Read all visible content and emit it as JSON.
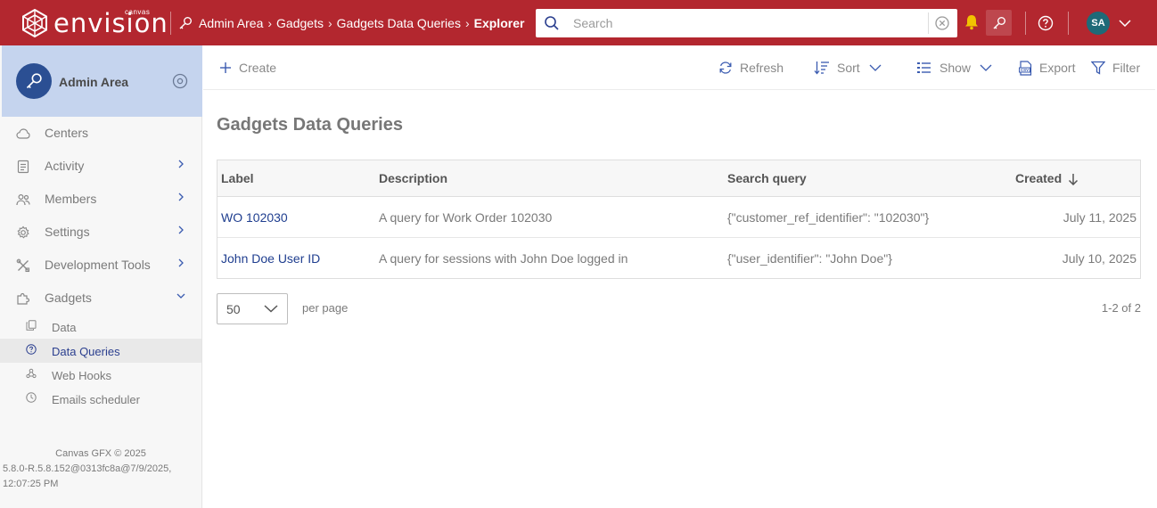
{
  "brand": {
    "small_word": "canvas",
    "name": "envision"
  },
  "breadcrumb": [
    "Admin Area",
    "Gadgets",
    "Gadgets Data Queries",
    "Explorer"
  ],
  "search": {
    "placeholder": "Search",
    "value": ""
  },
  "user": {
    "initials": "SA"
  },
  "sidebar": {
    "header_title": "Admin Area",
    "items": [
      {
        "label": "Centers",
        "icon": "cloud-icon"
      },
      {
        "label": "Activity",
        "icon": "activity-icon"
      },
      {
        "label": "Members",
        "icon": "members-icon"
      },
      {
        "label": "Settings",
        "icon": "gear-icon"
      },
      {
        "label": "Development Tools",
        "icon": "tools-icon"
      },
      {
        "label": "Gadgets",
        "icon": "puzzle-icon"
      }
    ],
    "subitems": [
      {
        "label": "Data",
        "icon": "copy-icon"
      },
      {
        "label": "Data Queries",
        "icon": "question-icon",
        "active": true
      },
      {
        "label": "Web Hooks",
        "icon": "webhook-icon"
      },
      {
        "label": "Emails scheduler",
        "icon": "clock-icon"
      }
    ],
    "footer": {
      "line1": "Canvas GFX © 2025",
      "line2": "5.8.0-R.5.8.152@0313fc8a@7/9/2025,",
      "line3": "12:07:25 PM"
    }
  },
  "toolbar": {
    "create": "Create",
    "refresh": "Refresh",
    "sort": "Sort",
    "show": "Show",
    "export": "Export",
    "filter": "Filter"
  },
  "page_title": "Gadgets Data Queries",
  "table": {
    "columns": [
      "Label",
      "Description",
      "Search query",
      "Created"
    ],
    "rows": [
      {
        "label": "WO 102030",
        "description": "A query for Work Order 102030",
        "query": "{\"customer_ref_identifier\": \"102030\"}",
        "created": "July 11, 2025"
      },
      {
        "label": "John Doe User ID",
        "description": "A query for sessions with John Doe logged in",
        "query": "{\"user_identifier\": \"John Doe\"}",
        "created": "July 10, 2025"
      }
    ]
  },
  "pagination": {
    "per_page": "50",
    "per_page_label": "per page",
    "range": "1-2 of 2"
  },
  "colors": {
    "topbar": "#b3272f",
    "sidebar_header": "#c5d4ee",
    "accent": "#2b4f93",
    "link": "#1f3e8f",
    "bell": "#f2c200"
  }
}
